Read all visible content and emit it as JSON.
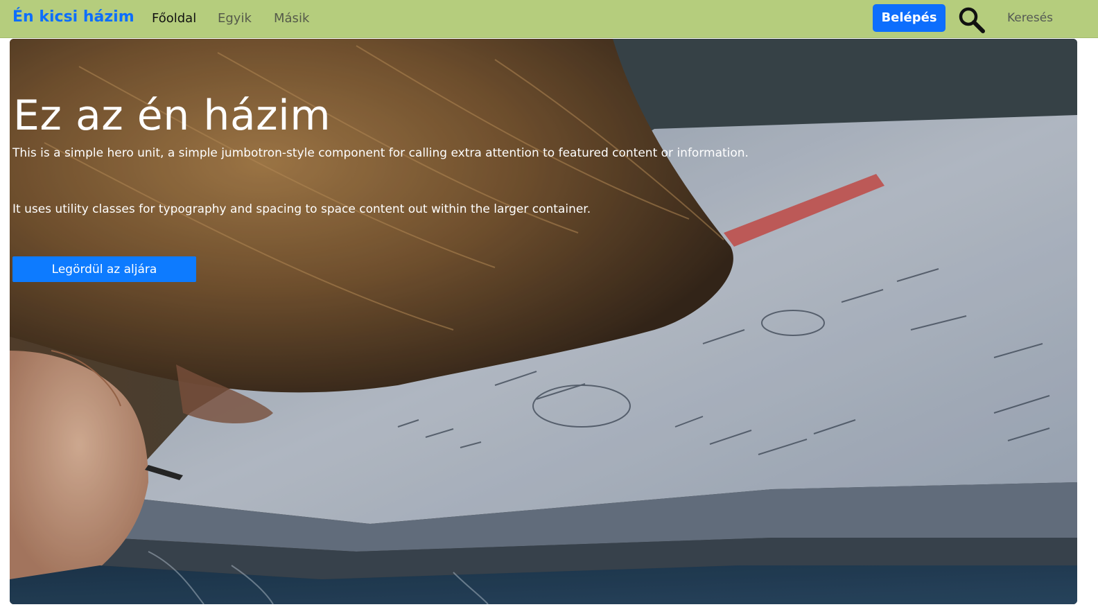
{
  "navbar": {
    "brand": "Én kicsi házim",
    "links": [
      {
        "label": "Főoldal",
        "active": true
      },
      {
        "label": "Egyik",
        "active": false
      },
      {
        "label": "Másik",
        "active": false
      }
    ],
    "login_label": "Belépés",
    "search": {
      "placeholder": "Keresés",
      "value": "",
      "icon": "search-icon"
    },
    "background_color": "#b5cd7d",
    "brand_color": "#0d6efd"
  },
  "hero": {
    "title": "Ez az én házim",
    "lead": "This is a simple hero unit, a simple jumbotron-style component for calling extra attention to featured content or information.",
    "body": "It uses utility classes for typography and spacing to space content out within the larger container.",
    "dropdown_label": "Legördül az aljára",
    "button_color": "#0d7bff"
  }
}
